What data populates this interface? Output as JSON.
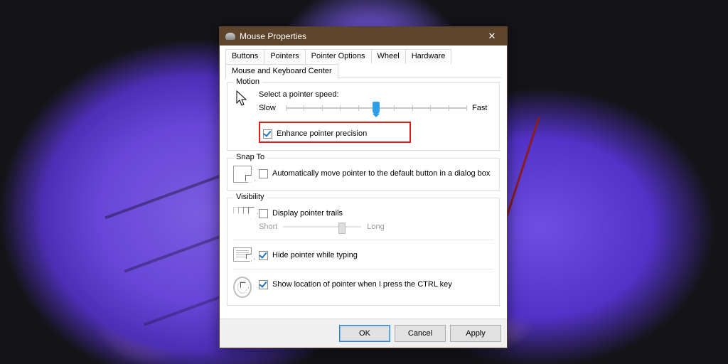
{
  "window": {
    "title": "Mouse Properties"
  },
  "tabs": [
    "Buttons",
    "Pointers",
    "Pointer Options",
    "Wheel",
    "Hardware",
    "Mouse and Keyboard Center"
  ],
  "active_tab": 2,
  "motion": {
    "legend": "Motion",
    "select_label": "Select a pointer speed:",
    "slow": "Slow",
    "fast": "Fast",
    "speed_pos_pct": 50,
    "enhance_label": "Enhance pointer precision",
    "enhance_checked": true
  },
  "snap": {
    "legend": "Snap To",
    "auto_label": "Automatically move pointer to the default button in a dialog box",
    "auto_checked": false
  },
  "visibility": {
    "legend": "Visibility",
    "trails_label": "Display pointer trails",
    "trails_checked": false,
    "trails_short": "Short",
    "trails_long": "Long",
    "hide_label": "Hide pointer while typing",
    "hide_checked": true,
    "ctrl_label": "Show location of pointer when I press the CTRL key",
    "ctrl_checked": true
  },
  "buttons": {
    "ok": "OK",
    "cancel": "Cancel",
    "apply": "Apply"
  }
}
